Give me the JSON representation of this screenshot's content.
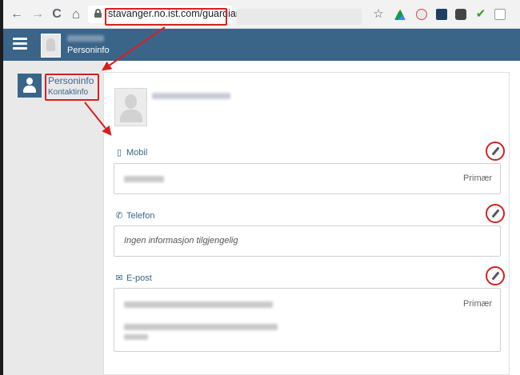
{
  "browser": {
    "url": "stavanger.no.ist.com/guardian",
    "nav_icons": [
      "back-icon",
      "forward-icon",
      "reload-icon",
      "home-icon"
    ],
    "back_glyph": "←",
    "forward_glyph": "→",
    "reload_glyph": "C",
    "home_glyph": "⌂",
    "star_glyph": "☆"
  },
  "header": {
    "subtitle": "Personinfo"
  },
  "sidebar": {
    "title": "Personinfo",
    "subtitle": "Kontaktinfo"
  },
  "sections": {
    "mobil": {
      "label": "Mobil",
      "icon": "mobile-icon",
      "tag": "Primær"
    },
    "telefon": {
      "label": "Telefon",
      "icon": "phone-icon",
      "empty": "Ingen informasjon tilgjengelig"
    },
    "epost": {
      "label": "E-post",
      "icon": "envelope-icon",
      "tag": "Primær"
    }
  },
  "colors": {
    "brand": "#3a6589",
    "highlight": "#d62020",
    "panel": "#e9e9e9"
  }
}
